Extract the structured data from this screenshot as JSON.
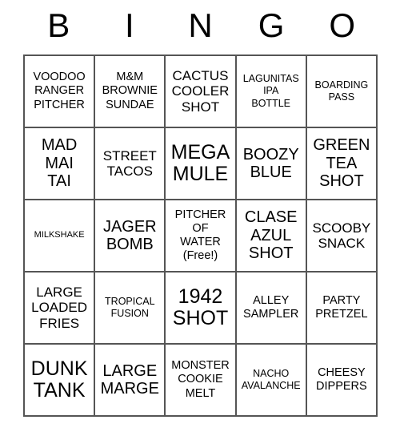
{
  "card": {
    "header_letters": [
      "B",
      "I",
      "N",
      "G",
      "O"
    ],
    "rows": [
      [
        {
          "text": "VOODOO\nRANGER\nPITCHER",
          "size": "t-md"
        },
        {
          "text": "M&M\nBROWNIE\nSUNDAE",
          "size": "t-md"
        },
        {
          "text": "CACTUS\nCOOLER\nSHOT",
          "size": "t-lg"
        },
        {
          "text": "LAGUNITAS\nIPA\nBOTTLE",
          "size": "t-sm"
        },
        {
          "text": "BOARDING\nPASS",
          "size": "t-sm"
        }
      ],
      [
        {
          "text": "MAD\nMAI\nTAI",
          "size": "t-xl"
        },
        {
          "text": "STREET\nTACOS",
          "size": "t-lg"
        },
        {
          "text": "MEGA\nMULE",
          "size": "t-xxl"
        },
        {
          "text": "BOOZY\nBLUE",
          "size": "t-xl"
        },
        {
          "text": "GREEN\nTEA\nSHOT",
          "size": "t-xl"
        }
      ],
      [
        {
          "text": "MILKSHAKE",
          "size": "t-xs"
        },
        {
          "text": "JAGER\nBOMB",
          "size": "t-xl"
        },
        {
          "text": "PITCHER\nOF\nWATER\n(Free!)",
          "size": "t-md"
        },
        {
          "text": "CLASE\nAZUL\nSHOT",
          "size": "t-xl"
        },
        {
          "text": "SCOOBY\nSNACK",
          "size": "t-lg"
        }
      ],
      [
        {
          "text": "LARGE\nLOADED\nFRIES",
          "size": "t-lg"
        },
        {
          "text": "TROPICAL\nFUSION",
          "size": "t-sm"
        },
        {
          "text": "1942\nSHOT",
          "size": "t-xxl"
        },
        {
          "text": "ALLEY\nSAMPLER",
          "size": "t-md"
        },
        {
          "text": "PARTY\nPRETZEL",
          "size": "t-md"
        }
      ],
      [
        {
          "text": "DUNK\nTANK",
          "size": "t-xxl"
        },
        {
          "text": "LARGE\nMARGE",
          "size": "t-xl"
        },
        {
          "text": "MONSTER\nCOOKIE\nMELT",
          "size": "t-md"
        },
        {
          "text": "NACHO\nAVALANCHE",
          "size": "t-sm"
        },
        {
          "text": "CHEESY\nDIPPERS",
          "size": "t-md"
        }
      ]
    ]
  },
  "colors": {
    "background": "#ffffff",
    "grid_line": "#555555",
    "text": "#000000"
  }
}
